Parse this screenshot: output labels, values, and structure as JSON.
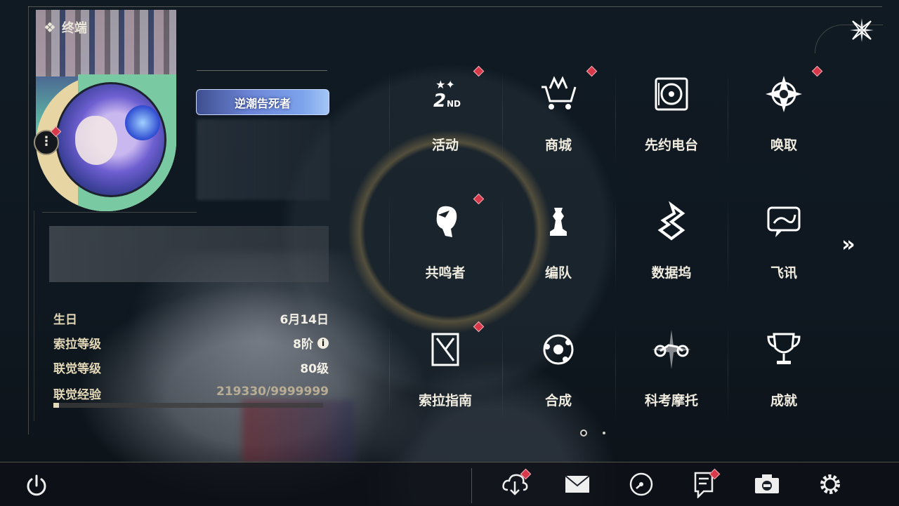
{
  "title": "终端",
  "profile": {
    "title_badge": "逆潮告死者",
    "stats": [
      {
        "label": "生日",
        "value": "6月14日"
      },
      {
        "label": "索拉等级",
        "value": "8阶"
      },
      {
        "label": "联觉等级",
        "value": "80级"
      }
    ],
    "exp": {
      "label": "联觉经验",
      "value": "219330/9999999",
      "progress": 0.022
    }
  },
  "grid": [
    {
      "label": "活动",
      "icon": "event-2nd-icon",
      "badge": true
    },
    {
      "label": "商城",
      "icon": "shop-crown-cart-icon",
      "badge": true
    },
    {
      "label": "先约电台",
      "icon": "radio-record-icon",
      "badge": false
    },
    {
      "label": "唤取",
      "icon": "convene-compass-icon",
      "badge": true
    },
    {
      "label": "共鸣者",
      "icon": "resonator-head-icon",
      "badge": true
    },
    {
      "label": "编队",
      "icon": "team-chess-icon",
      "badge": false
    },
    {
      "label": "数据坞",
      "icon": "data-bank-icon",
      "badge": false
    },
    {
      "label": "飞讯",
      "icon": "message-chat-icon",
      "badge": false
    },
    {
      "label": "索拉指南",
      "icon": "guide-book-icon",
      "badge": true
    },
    {
      "label": "合成",
      "icon": "synthesis-ring-icon",
      "badge": false
    },
    {
      "label": "科考摩托",
      "icon": "motorcycle-icon",
      "badge": false
    },
    {
      "label": "成就",
      "icon": "trophy-icon",
      "badge": false
    }
  ],
  "bottom_icons": [
    "download-cloud-icon",
    "mail-icon",
    "clock-icon",
    "notice-icon",
    "camera-icon",
    "settings-gear-icon"
  ],
  "colors": {
    "accent": "#e2d7b6",
    "badge": "#d8394a"
  }
}
